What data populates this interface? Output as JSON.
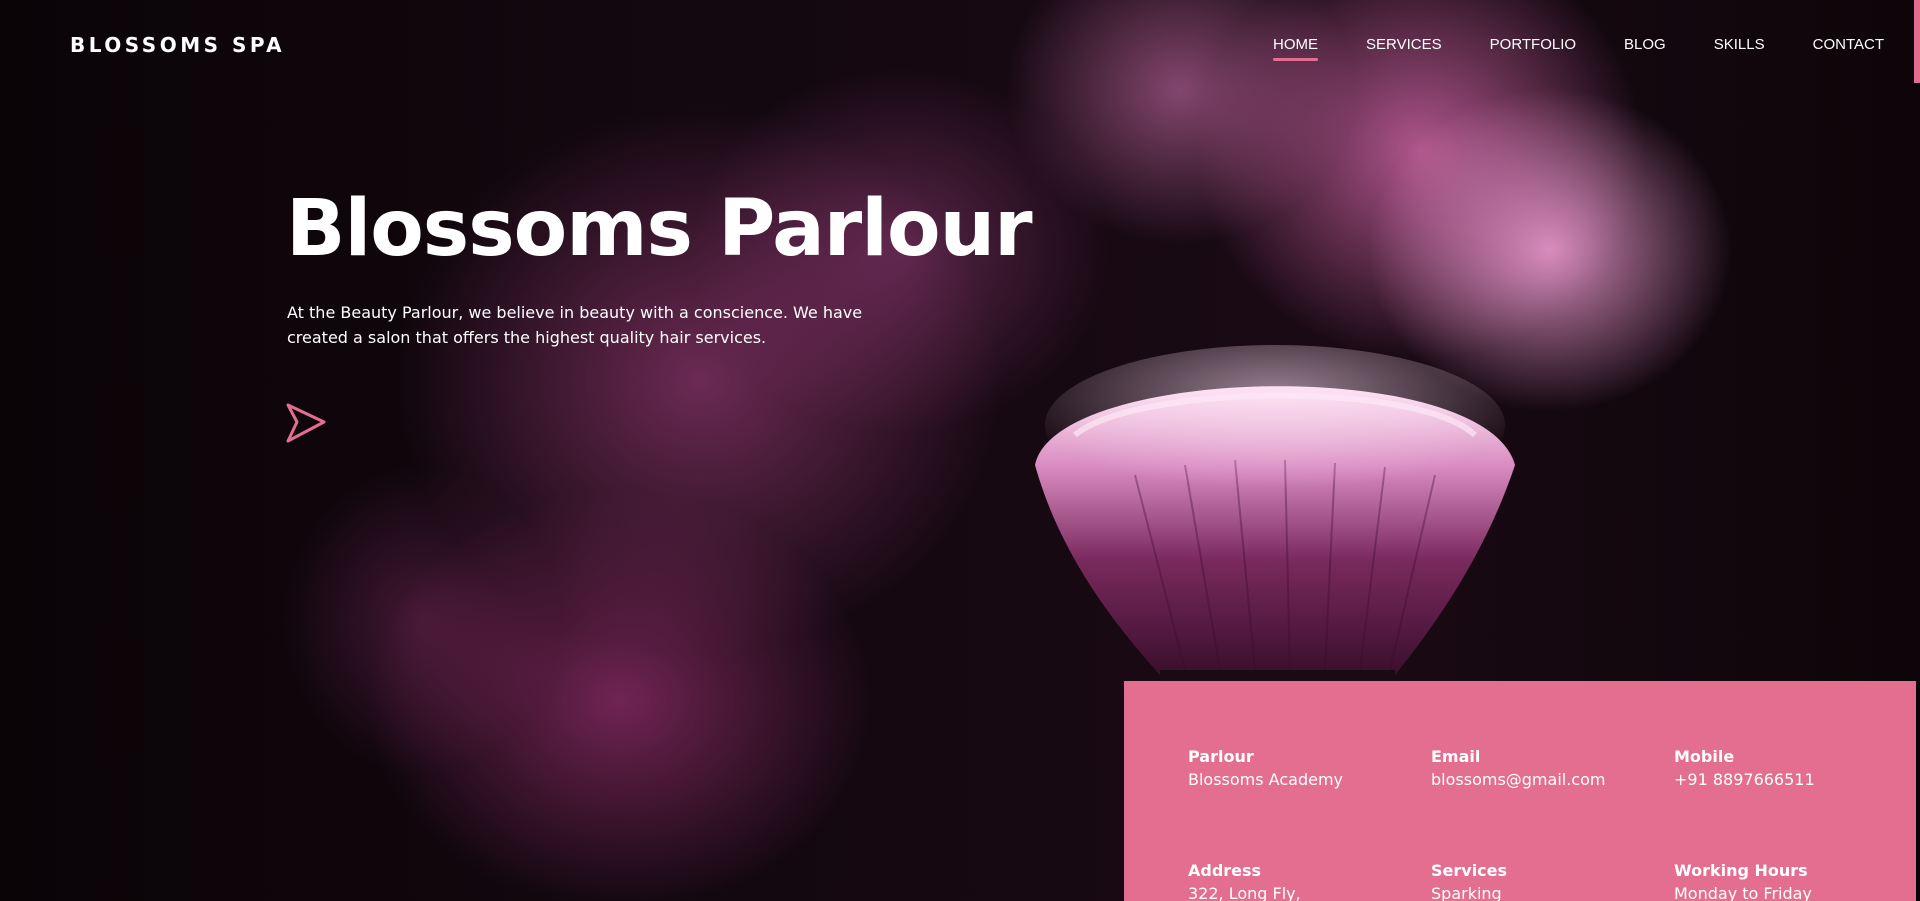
{
  "header": {
    "logo": "BLOSSOMS SPA",
    "nav": [
      {
        "label": "HOME",
        "active": true
      },
      {
        "label": "SERVICES",
        "active": false
      },
      {
        "label": "PORTFOLIO",
        "active": false
      },
      {
        "label": "BLOG",
        "active": false
      },
      {
        "label": "SKILLS",
        "active": false
      },
      {
        "label": "CONTACT",
        "active": false
      }
    ]
  },
  "hero": {
    "title": "Blossoms Parlour",
    "text": "At the Beauty Parlour, we believe in beauty with a conscience. We have created a salon that offers the highest quality hair services.",
    "play_icon": "play-triangle-outline-icon"
  },
  "info": {
    "parlour": {
      "label": "Parlour",
      "value": "Blossoms Academy"
    },
    "email": {
      "label": "Email",
      "value": "blossoms@gmail.com"
    },
    "mobile": {
      "label": "Mobile",
      "value": "+91 8897666511"
    },
    "address": {
      "label": "Address",
      "value": "322, Long Fly,"
    },
    "services": {
      "label": "Services",
      "value": "Sparking"
    },
    "hours": {
      "label": "Working Hours",
      "value": "Monday to Friday"
    }
  },
  "colors": {
    "accent": "#e46e90",
    "background": "#0c0509",
    "text": "#ffffff"
  }
}
